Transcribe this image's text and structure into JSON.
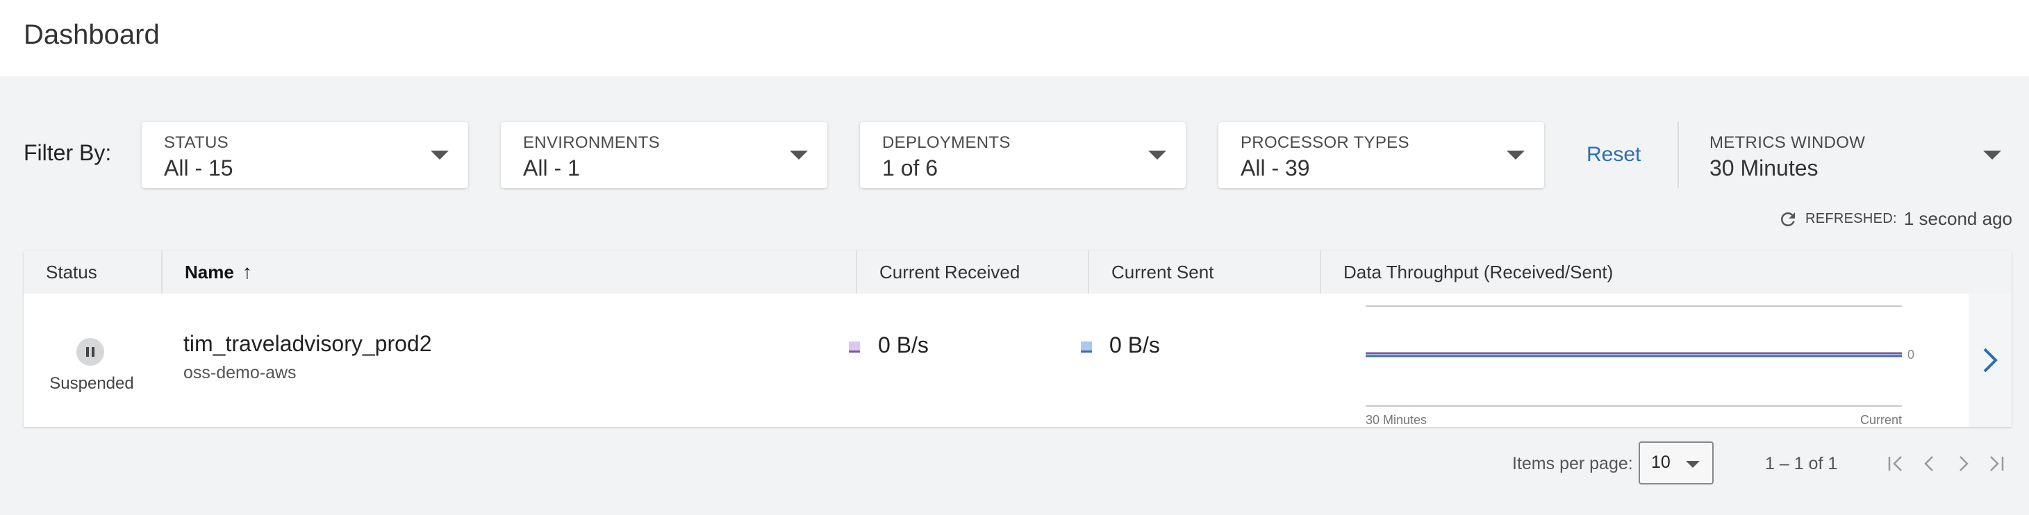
{
  "header": {
    "title": "Dashboard"
  },
  "filters": {
    "label": "Filter By:",
    "items": [
      {
        "caption": "STATUS",
        "value": "All - 15"
      },
      {
        "caption": "ENVIRONMENTS",
        "value": "All - 1"
      },
      {
        "caption": "DEPLOYMENTS",
        "value": "1 of 6"
      },
      {
        "caption": "PROCESSOR TYPES",
        "value": "All - 39"
      }
    ],
    "reset_label": "Reset",
    "metrics_window": {
      "caption": "METRICS WINDOW",
      "value": "30 Minutes"
    }
  },
  "refresh": {
    "label": "REFRESHED:",
    "value": "1 second ago",
    "icon": "refresh-icon"
  },
  "table": {
    "columns": [
      {
        "label": "Status"
      },
      {
        "label": "Name",
        "sort": "ascending"
      },
      {
        "label": "Current Received"
      },
      {
        "label": "Current Sent"
      },
      {
        "label": "Data Throughput (Received/Sent)"
      }
    ],
    "rows": [
      {
        "status": "Suspended",
        "status_icon": "pause-icon",
        "name": "tim_traveladvisory_prod2",
        "environment": "oss-demo-aws",
        "current_received": "0 B/s",
        "current_sent": "0 B/s",
        "throughput": {
          "y_label": "0",
          "x_start_label": "30 Minutes",
          "x_end_label": "Current",
          "received_color": "#7a5aa6",
          "sent_color": "#3a6db0",
          "received_values": [
            0,
            0
          ],
          "sent_values": [
            0,
            0
          ]
        }
      }
    ]
  },
  "pagination": {
    "items_per_page_label": "Items per page:",
    "items_per_page_value": "10",
    "range": "1 – 1 of 1"
  },
  "colors": {
    "accent": "#2d6db5",
    "background": "#f2f3f5"
  }
}
